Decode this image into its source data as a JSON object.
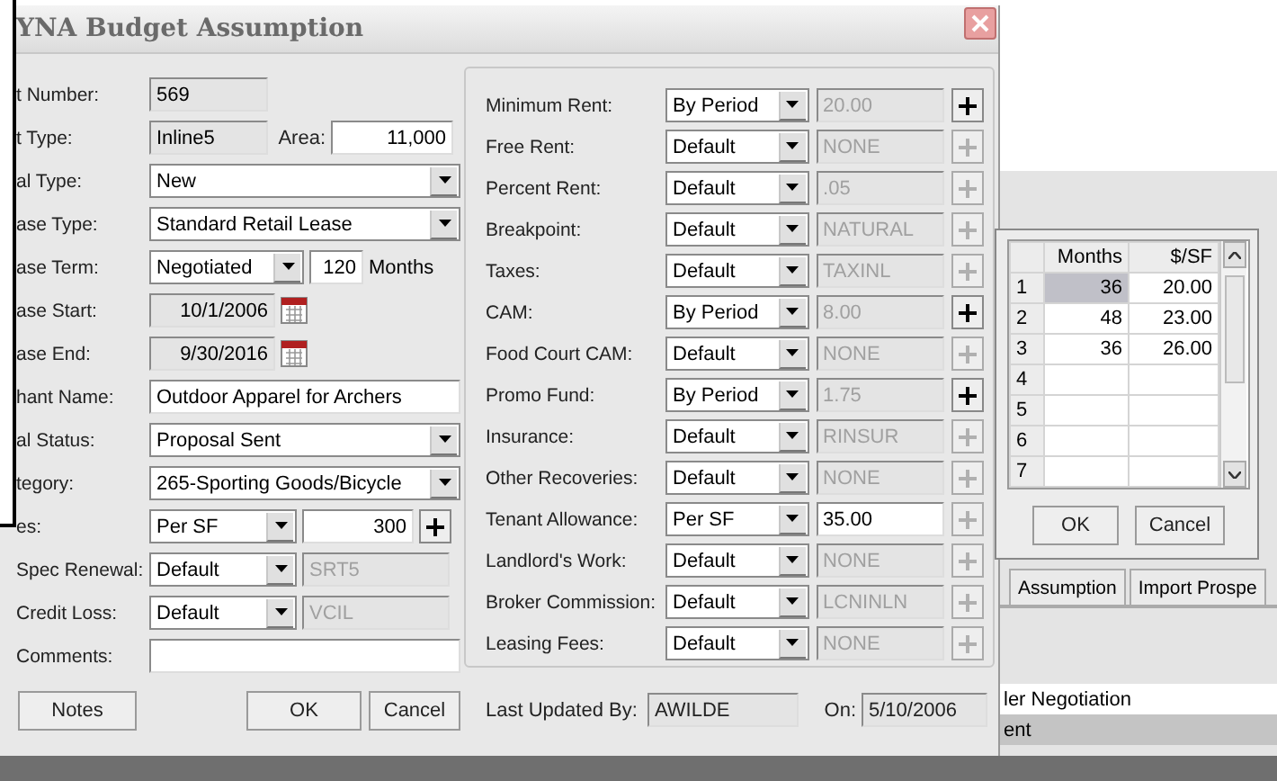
{
  "window": {
    "title": "YNA Budget Assumption"
  },
  "left_fields": [
    {
      "label": "t Number:",
      "kind": "readonly",
      "value": "569"
    },
    {
      "label": "t Type:",
      "kind": "readonly_area",
      "value": "Inline5",
      "extra_label": "Area:",
      "extra_value": "11,000"
    },
    {
      "label": "al Type:",
      "kind": "dropdown",
      "value": "New"
    },
    {
      "label": "ase Type:",
      "kind": "dropdown",
      "value": "Standard Retail Lease"
    },
    {
      "label": "ase Term:",
      "kind": "term",
      "value": "Negotiated",
      "number": "120",
      "unit": "Months"
    },
    {
      "label": "ase Start:",
      "kind": "date",
      "value": "10/1/2006"
    },
    {
      "label": "ase End:",
      "kind": "date",
      "value": "9/30/2016"
    },
    {
      "label": "hant Name:",
      "kind": "text",
      "value": "Outdoor Apparel for Archers"
    },
    {
      "label": "al Status:",
      "kind": "dropdown",
      "value": "Proposal Sent"
    },
    {
      "label": "tegory:",
      "kind": "dropdown",
      "value": "265-Sporting Goods/Bicycle"
    },
    {
      "label": "es:",
      "kind": "option_add",
      "method": "Per SF",
      "value": "300",
      "value_enabled": true,
      "plus_enabled": true
    },
    {
      "label": "Spec Renewal:",
      "kind": "option",
      "method": "Default",
      "value": "SRT5",
      "value_enabled": false
    },
    {
      "label": "Credit Loss:",
      "kind": "option",
      "method": "Default",
      "value": "VCIL",
      "value_enabled": false
    },
    {
      "label": "Comments:",
      "kind": "text"
    }
  ],
  "right_fields": [
    {
      "label": "Minimum Rent:",
      "method": "By Period",
      "value": "20.00",
      "value_enabled": false,
      "plus_enabled": true
    },
    {
      "label": "Free Rent:",
      "method": "Default",
      "value": "NONE",
      "value_enabled": false,
      "plus_enabled": false
    },
    {
      "label": "Percent Rent:",
      "method": "Default",
      "value": ".05",
      "value_enabled": false,
      "plus_enabled": false
    },
    {
      "label": "Breakpoint:",
      "method": "Default",
      "value": "NATURAL",
      "value_enabled": false,
      "plus_enabled": false
    },
    {
      "label": "Taxes:",
      "method": "Default",
      "value": "TAXINL",
      "value_enabled": false,
      "plus_enabled": false
    },
    {
      "label": "CAM:",
      "method": "By Period",
      "value": "8.00",
      "value_enabled": false,
      "plus_enabled": true
    },
    {
      "label": "Food Court CAM:",
      "method": "Default",
      "value": "NONE",
      "value_enabled": false,
      "plus_enabled": false
    },
    {
      "label": "Promo Fund:",
      "method": "By Period",
      "value": "1.75",
      "value_enabled": false,
      "plus_enabled": true
    },
    {
      "label": "Insurance:",
      "method": "Default",
      "value": "RINSUR",
      "value_enabled": false,
      "plus_enabled": false
    },
    {
      "label": "Other Recoveries:",
      "method": "Default",
      "value": "NONE",
      "value_enabled": false,
      "plus_enabled": false
    },
    {
      "label": "Tenant Allowance:",
      "method": "Per SF",
      "value": "35.00",
      "value_enabled": true,
      "plus_enabled": false
    },
    {
      "label": "Landlord's Work:",
      "method": "Default",
      "value": "NONE",
      "value_enabled": false,
      "plus_enabled": false
    },
    {
      "label": "Broker Commission:",
      "method": "Default",
      "value": "LCNINLN",
      "value_enabled": false,
      "plus_enabled": false
    },
    {
      "label": "Leasing Fees:",
      "method": "Default",
      "value": "NONE",
      "value_enabled": false,
      "plus_enabled": false
    }
  ],
  "footer": {
    "notes_button": "Notes",
    "ok_button": "OK",
    "cancel_button": "Cancel",
    "updated_label": "Last Updated By:",
    "updated_by": "AWILDE",
    "on_label": "On:",
    "updated_on": "5/10/2006"
  },
  "popup": {
    "columns": [
      "Months",
      "$/SF"
    ],
    "rows": [
      {
        "number": "1",
        "cells": [
          {
            "text": "36",
            "selected": true
          },
          {
            "text": "20.00",
            "selected": false
          }
        ]
      },
      {
        "number": "2",
        "cells": [
          {
            "text": "48",
            "selected": false
          },
          {
            "text": "23.00",
            "selected": false
          }
        ]
      },
      {
        "number": "3",
        "cells": [
          {
            "text": "36",
            "selected": false
          },
          {
            "text": "26.00",
            "selected": false
          }
        ]
      },
      {
        "number": "4",
        "cells": [
          {
            "selected": false
          },
          {
            "selected": false
          }
        ]
      },
      {
        "number": "5",
        "cells": [
          {
            "selected": false
          },
          {
            "selected": false
          }
        ]
      },
      {
        "number": "6",
        "cells": [
          {
            "selected": false
          },
          {
            "selected": false
          }
        ]
      },
      {
        "number": "7",
        "cells": [
          {
            "selected": false
          },
          {
            "selected": false
          }
        ]
      }
    ],
    "ok_button": "OK",
    "cancel_button": "Cancel"
  },
  "background_window": {
    "tabs": [
      "Assumption",
      "Import Prospe"
    ],
    "list": [
      {
        "text": "ler Negotiation",
        "selected": false
      },
      {
        "text": "ent",
        "selected": true
      }
    ]
  }
}
